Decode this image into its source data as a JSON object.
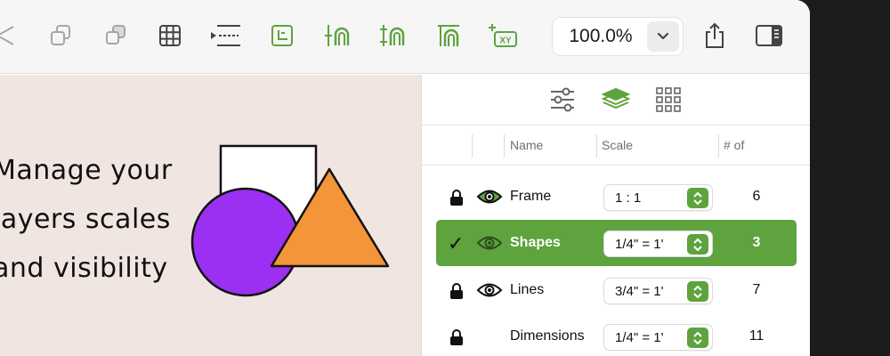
{
  "toolbar": {
    "buttons": [
      {
        "icon": "send-backward-icon"
      },
      {
        "icon": "group-icon"
      },
      {
        "icon": "ungroup-icon"
      },
      {
        "icon": "grid-icon"
      },
      {
        "icon": "dimension-icon"
      },
      {
        "icon": "crop-frame-icon"
      },
      {
        "icon": "layer-align-icon"
      },
      {
        "icon": "layer-scale-icon"
      },
      {
        "icon": "layer-anchor-icon"
      },
      {
        "icon": "xy-coordinates-icon"
      }
    ],
    "zoom_value": "100.0%",
    "share_icon": "share-icon",
    "sidebar_icon": "sidebar-toggle-icon"
  },
  "colors": {
    "accent": "#5ea33e",
    "canvas_bg": "#f1e5e2",
    "purple": "#9b2ff2",
    "orange": "#f39538"
  },
  "promo": {
    "lines": [
      "Manage your",
      "layers scales",
      "and visibility"
    ]
  },
  "inspector": {
    "tabs": [
      {
        "icon": "sliders-icon",
        "active": false
      },
      {
        "icon": "layers-icon",
        "active": true
      },
      {
        "icon": "grid-dots-icon",
        "active": false
      }
    ],
    "columns": {
      "name": "Name",
      "scale": "Scale",
      "count": "# of"
    },
    "layers": [
      {
        "name": "Frame",
        "scale": "1 : 1",
        "count": "6",
        "locked": true,
        "visible": true,
        "selected": false
      },
      {
        "name": "Shapes",
        "scale": "1/4\" = 1'",
        "count": "3",
        "locked": false,
        "visible": true,
        "selected": true
      },
      {
        "name": "Lines",
        "scale": "3/4\" = 1'",
        "count": "7",
        "locked": true,
        "visible": true,
        "selected": false
      },
      {
        "name": "Dimensions",
        "scale": "1/4\" = 1'",
        "count": "11",
        "locked": true,
        "visible": false,
        "selected": false
      }
    ]
  }
}
